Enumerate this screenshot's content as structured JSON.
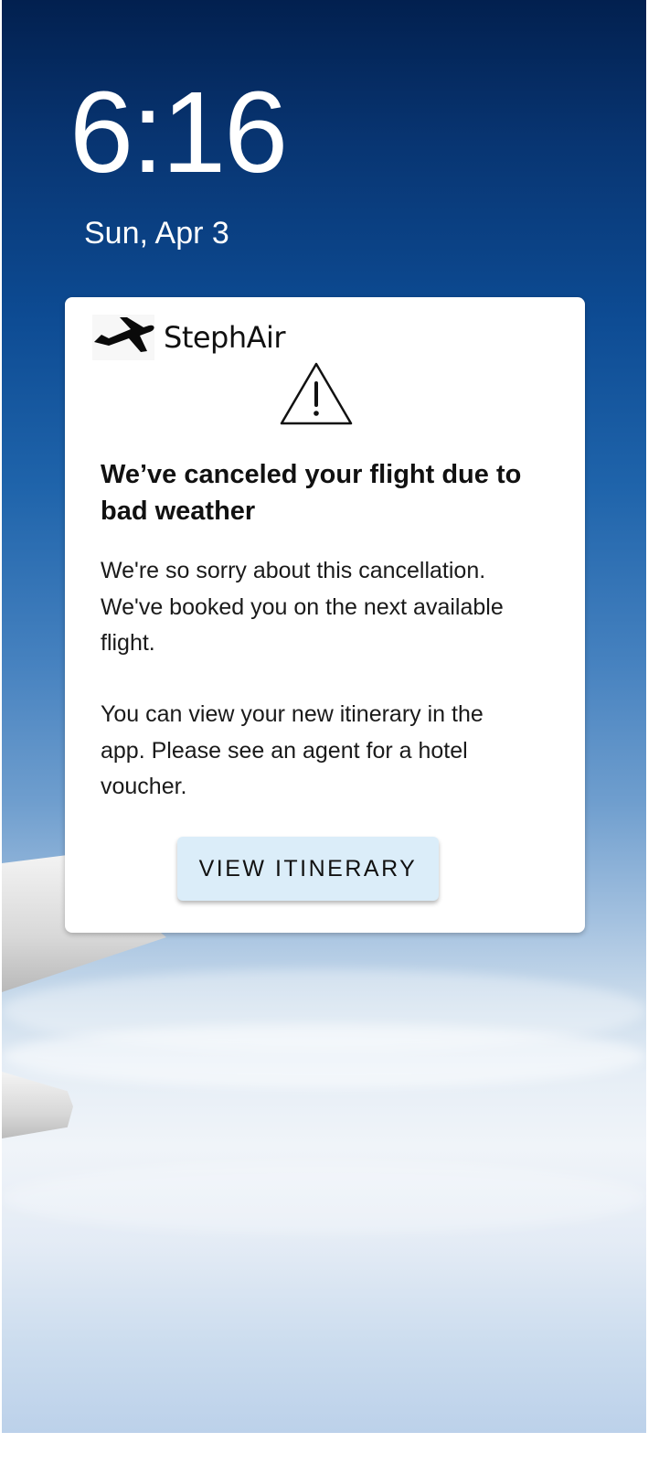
{
  "lockscreen": {
    "time": "6:16",
    "date": "Sun, Apr 3"
  },
  "notification": {
    "app_name": "StephAir",
    "app_icon": "airplane-icon",
    "alert_icon": "warning-triangle-icon",
    "headline": "We’ve canceled your flight due to bad weather",
    "body_1": "We're so sorry about this cancellation. We've booked you on the next available flight.",
    "body_2": "You can view your new itinerary in the app. Please see an agent for a hotel voucher.",
    "button_label": "VIEW ITINERARY"
  },
  "colors": {
    "button_bg": "#dbedf9",
    "card_bg": "#ffffff",
    "sky_top": "#02204f"
  }
}
